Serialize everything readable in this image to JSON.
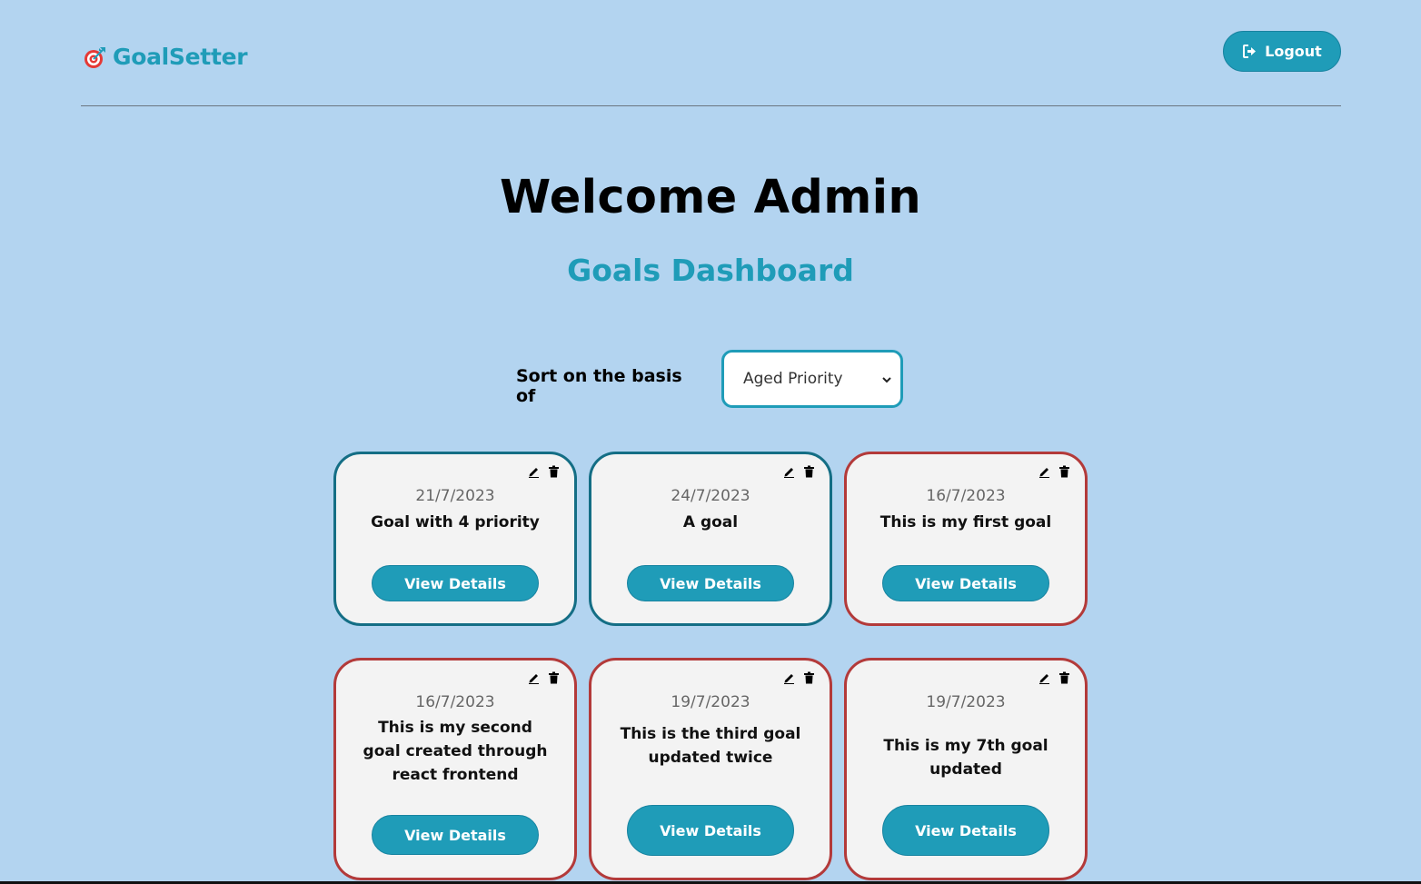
{
  "brand": {
    "name": "GoalSetter",
    "icon": "target-icon",
    "color": "#1f9cb8"
  },
  "header": {
    "logout_label": "Logout",
    "logout_icon": "sign-out-icon"
  },
  "welcome": "Welcome Admin",
  "dashboard_title": "Goals Dashboard",
  "sort": {
    "label": "Sort on the basis of",
    "selected": "Aged Priority"
  },
  "colors": {
    "background": "#b3d4f0",
    "accent": "#1f9cb8",
    "border_teal": "#146e85",
    "border_red": "#b33a3a"
  },
  "goals": [
    {
      "date": "21/7/2023",
      "text": "Goal with 4 priority",
      "button": "View Details",
      "status": "teal"
    },
    {
      "date": "24/7/2023",
      "text": "A goal",
      "button": "View Details",
      "status": "teal"
    },
    {
      "date": "16/7/2023",
      "text": "This is my first goal",
      "button": "View Details",
      "status": "red"
    },
    {
      "date": "16/7/2023",
      "text": "This is my second goal created through react frontend",
      "button": "View Details",
      "status": "red"
    },
    {
      "date": "19/7/2023",
      "text": "This is the third goal updated twice",
      "button": "View Details",
      "status": "red"
    },
    {
      "date": "19/7/2023",
      "text": "This is my 7th goal updated",
      "button": "View Details",
      "status": "red"
    }
  ]
}
